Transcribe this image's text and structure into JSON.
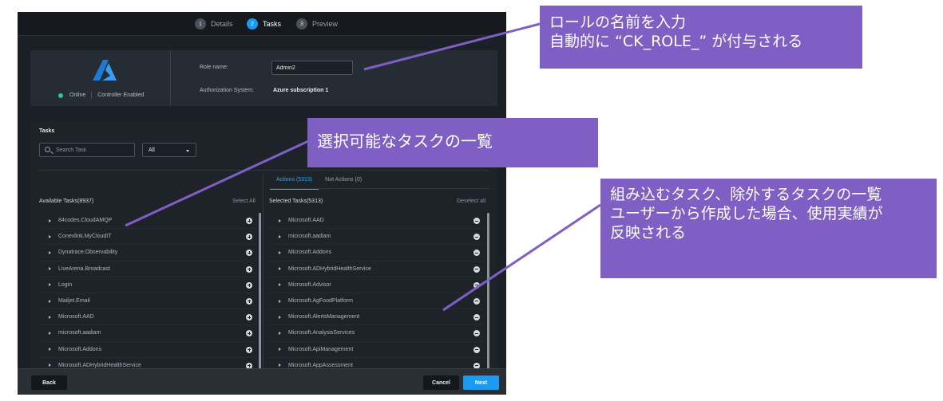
{
  "stepper": {
    "steps": [
      {
        "num": "1",
        "label": "Details"
      },
      {
        "num": "2",
        "label": "Tasks"
      },
      {
        "num": "3",
        "label": "Preview"
      }
    ]
  },
  "role_card": {
    "status_online": "Online",
    "status_controller": "Controller Enabled",
    "role_name_label": "Role name:",
    "role_name_value": "Admin2",
    "auth_system_label": "Authorization System:",
    "auth_system_value": "Azure subscription 1"
  },
  "tasks": {
    "title": "Tasks",
    "search_placeholder": "Search Task",
    "filter_value": "All",
    "tabs": [
      {
        "label": "Actions (5313)"
      },
      {
        "label": "Not Actions (0)"
      }
    ],
    "available_header": "Available Tasks(8937)",
    "select_all": "Select All",
    "selected_header": "Selected Tasks(5313)",
    "deselect_all": "Deselect all",
    "available_items": [
      "84codes.CloudAMQP",
      "Conexlink.MyCloudIT",
      "Dynatrace.Observability",
      "LiveArena.Broadcast",
      "Login",
      "Mailjet.Email",
      "Microsoft.AAD",
      "microsoft.aadiam",
      "Microsoft.Addons",
      "Microsoft.ADHybridHealthService"
    ],
    "selected_items": [
      "Microsoft.AAD",
      "microsoft.aadiam",
      "Microsoft.Addons",
      "Microsoft.ADHybridHealthService",
      "Microsoft.Advisor",
      "Microsoft.AgFoodPlatform",
      "Microsoft.AlertsManagement",
      "Microsoft.AnalysisServices",
      "Microsoft.ApiManagement",
      "Microsoft.AppAssessment"
    ]
  },
  "footer": {
    "back": "Back",
    "cancel": "Cancel",
    "next": "Next"
  },
  "annotations": {
    "role_callout": [
      "ロールの名前を入力",
      "自動的に “CK_ROLE_” が付与される"
    ],
    "tasks_callout": [
      "選択可能なタスクの一覧"
    ],
    "selected_callout": [
      "組み込むタスク、除外するタスクの一覧",
      "ユーザーから作成した場合、使用実績が",
      "反映される"
    ],
    "color": "#7f5fc4"
  },
  "colors": {
    "accent": "#1a9bf0",
    "online": "#2ec4a0",
    "azure": "#1f7ad6"
  },
  "icons": [
    "azure-logo-icon",
    "search-icon",
    "chevron-down-icon",
    "expand-arrow-icon",
    "add-circle-icon",
    "remove-circle-icon"
  ]
}
